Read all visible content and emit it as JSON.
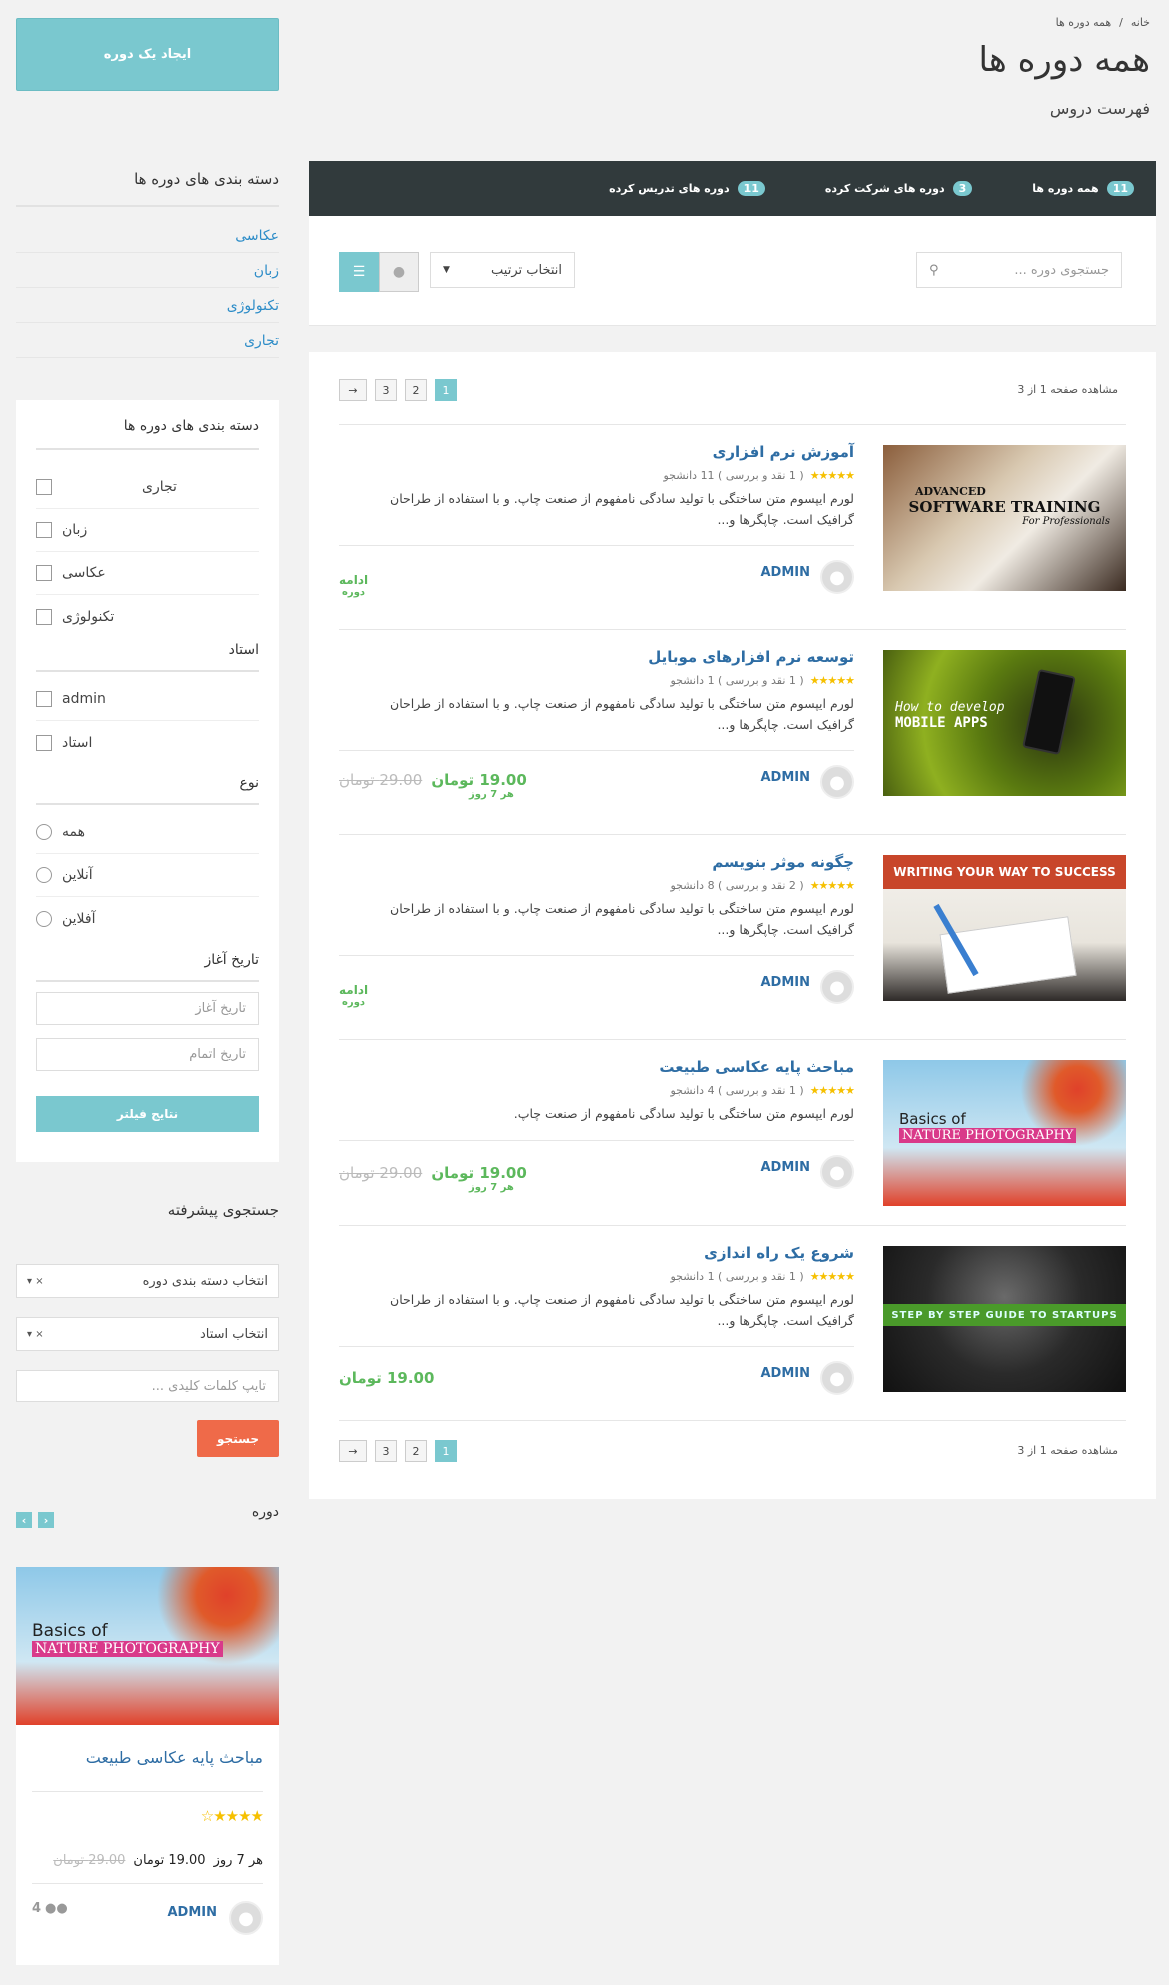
{
  "breadcrumb": {
    "home": "خانه",
    "sep": "/",
    "current": "همه دوره ها"
  },
  "page": {
    "title": "همه دوره ها",
    "subtitle": "فهرست دروس"
  },
  "create_button": "ایجاد یک دوره",
  "tabs": [
    {
      "label": "همه دوره ها",
      "count": "11"
    },
    {
      "label": "دوره های شرکت کرده",
      "count": "3"
    },
    {
      "label": "دوره های تدریس کرده",
      "count": "11"
    }
  ],
  "toolbar": {
    "search_placeholder": "جستجوی دوره ...",
    "sort_label": "انتخاب ترتیب"
  },
  "pagination": {
    "info": "مشاهده صفحه 1 از 3",
    "pages": [
      "1",
      "2",
      "3"
    ],
    "next": "→"
  },
  "courses": [
    {
      "title": "آموزش نرم افزاری",
      "meta": "( 1 نقد و بررسی ) 11 دانشجو",
      "desc": "لورم ایپسوم متن ساختگی با تولید سادگی نامفهوم از صنعت چاپ. و با استفاده از طراحان گرافیک است. چاپگرها و...",
      "author": "ADMIN",
      "more": "ادامه",
      "more_sub": "دوره",
      "thumb": {
        "line1": "ADVANCED",
        "line2": "SOFTWARE TRAINING",
        "line3": "For Professionals"
      }
    },
    {
      "title": "توسعه نرم افزارهای موبایل",
      "meta": "( 1 نقد و بررسی ) 1 دانشجو",
      "desc": "لورم ایپسوم متن ساختگی با تولید سادگی نامفهوم از صنعت چاپ. و با استفاده از طراحان گرافیک است. چاپگرها و...",
      "author": "ADMIN",
      "price": "19.00 تومان",
      "old_price": "29.00 تومان",
      "period": "هر 7 روز",
      "thumb": {
        "line1": "How to develop",
        "line2": "MOBILE APPS"
      }
    },
    {
      "title": "چگونه موثر بنویسم",
      "meta": "( 2 نقد و بررسی ) 8 دانشجو",
      "desc": "لورم ایپسوم متن ساختگی با تولید سادگی نامفهوم از صنعت چاپ. و با استفاده از طراحان گرافیک است. چاپگرها و...",
      "author": "ADMIN",
      "more": "ادامه",
      "more_sub": "دوره",
      "thumb": {
        "line1": "WRITING YOUR WAY TO SUCCESS"
      }
    },
    {
      "title": "مباحث پایه عکاسی طبیعت",
      "meta": "( 1 نقد و بررسی ) 4 دانشجو",
      "desc": "لورم ایپسوم متن ساختگی با تولید سادگی نامفهوم از صنعت چاپ.",
      "author": "ADMIN",
      "price": "19.00 تومان",
      "old_price": "29.00 تومان",
      "period": "هر 7 روز",
      "thumb": {
        "line1": "Basics of",
        "line2": "NATURE PHOTOGRAPHY"
      }
    },
    {
      "title": "شروع یک راه اندازی",
      "meta": "( 1 نقد و بررسی ) 1 دانشجو",
      "desc": "لورم ایپسوم متن ساختگی با تولید سادگی نامفهوم از صنعت چاپ. و با استفاده از طراحان گرافیک است. چاپگرها و...",
      "author": "ADMIN",
      "price": "19.00 تومان",
      "thumb": {
        "line1": "STEP BY STEP GUIDE TO STARTUPS"
      }
    }
  ],
  "sidebar": {
    "categories_title": "دسته بندی های دوره ها",
    "categories": [
      "عکاسی",
      "زبان",
      "تکنولوژی",
      "تجاری"
    ],
    "filter": {
      "title": "دسته بندی های دوره ها",
      "cats": [
        "تجاری",
        "زبان",
        "عکاسی",
        "تکنولوژی"
      ],
      "instructor_title": "استاد",
      "instructors": [
        "admin",
        "استاد"
      ],
      "type_title": "نوع",
      "types": [
        "همه",
        "آنلاین",
        "آفلاین"
      ],
      "date_title": "تاریخ آغاز",
      "start_placeholder": "تاریخ آغاز",
      "end_placeholder": "تاریخ اتمام",
      "button": "نتایج فیلتر"
    },
    "advanced": {
      "title": "جستجوی پیشرفته",
      "category_select": "انتخاب دسته بندی دوره",
      "instructor_select": "انتخاب استاد",
      "keywords_placeholder": "تایپ کلمات کلیدی ...",
      "button": "جستجو"
    },
    "widget": {
      "title": "دوره",
      "course_title": "مباحث پایه عکاسی طبیعت",
      "price": "19.00 تومان",
      "old_price": "29.00 تومان",
      "period": "هر 7 روز",
      "author": "ADMIN",
      "students": "4",
      "thumb": {
        "line1": "Basics of",
        "line2": "NATURE PHOTOGRAPHY"
      }
    }
  },
  "colors": {
    "accent": "#7ac8cf",
    "dark_bar": "#313a3c",
    "link": "#2e6da4",
    "price": "#5cb85c",
    "search_button": "#ef6a49"
  }
}
